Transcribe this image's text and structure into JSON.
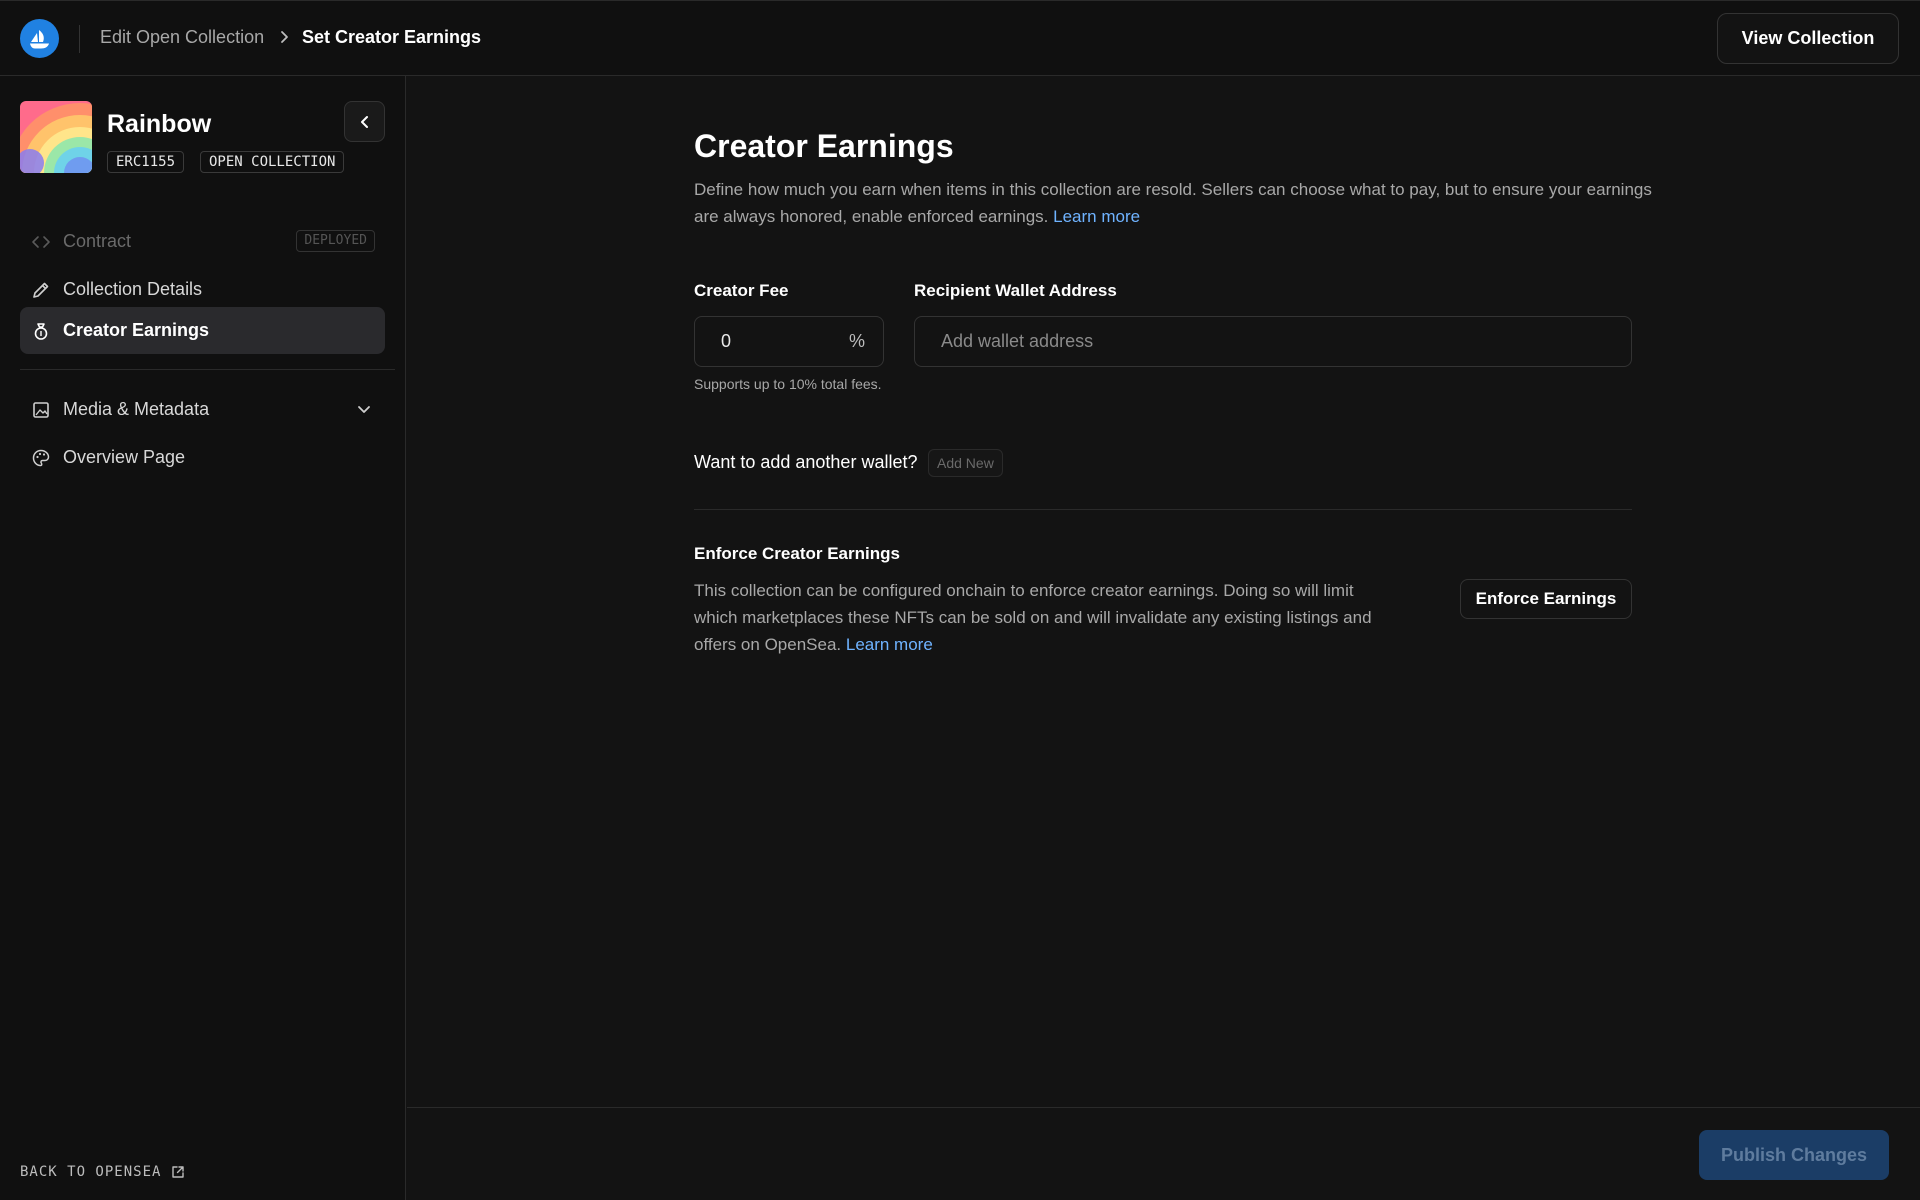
{
  "header": {
    "breadcrumb_parent": "Edit Open Collection",
    "breadcrumb_current": "Set Creator Earnings",
    "view_collection_label": "View Collection"
  },
  "sidebar": {
    "collection_name": "Rainbow",
    "tags": [
      "ERC1155",
      "OPEN COLLECTION"
    ],
    "items": [
      {
        "label": "Contract",
        "badge": "DEPLOYED",
        "icon": "code-icon",
        "state": "disabled"
      },
      {
        "label": "Collection Details",
        "icon": "pencil-icon"
      },
      {
        "label": "Creator Earnings",
        "icon": "money-bag-icon",
        "state": "active"
      },
      {
        "label": "Media & Metadata",
        "icon": "image-icon",
        "expandable": true
      },
      {
        "label": "Overview Page",
        "icon": "palette-icon"
      }
    ],
    "back_link": "BACK TO OPENSEA"
  },
  "main": {
    "title": "Creator Earnings",
    "description": "Define how much you earn when items in this collection are resold. Sellers can choose what to pay, but to ensure your earnings are always honored, enable enforced earnings.",
    "learn_more": "Learn more",
    "creator_fee": {
      "label": "Creator Fee",
      "value": "0",
      "suffix": "%",
      "help": "Supports up to 10% total fees."
    },
    "wallet": {
      "label": "Recipient Wallet Address",
      "placeholder": "Add wallet address"
    },
    "add_wallet_question": "Want to add another wallet?",
    "add_new_label": "Add New",
    "enforce": {
      "title": "Enforce Creator Earnings",
      "description": "This collection can be configured onchain to enforce creator earnings. Doing so will limit which marketplaces these NFTs can be sold on and will invalidate any existing listings and offers on OpenSea.",
      "learn_more": "Learn more",
      "button_label": "Enforce Earnings"
    }
  },
  "footer": {
    "publish_label": "Publish Changes"
  },
  "colors": {
    "brand": "#2081e2",
    "link": "#6fb3ff",
    "publish_disabled": "#1b3d66"
  }
}
